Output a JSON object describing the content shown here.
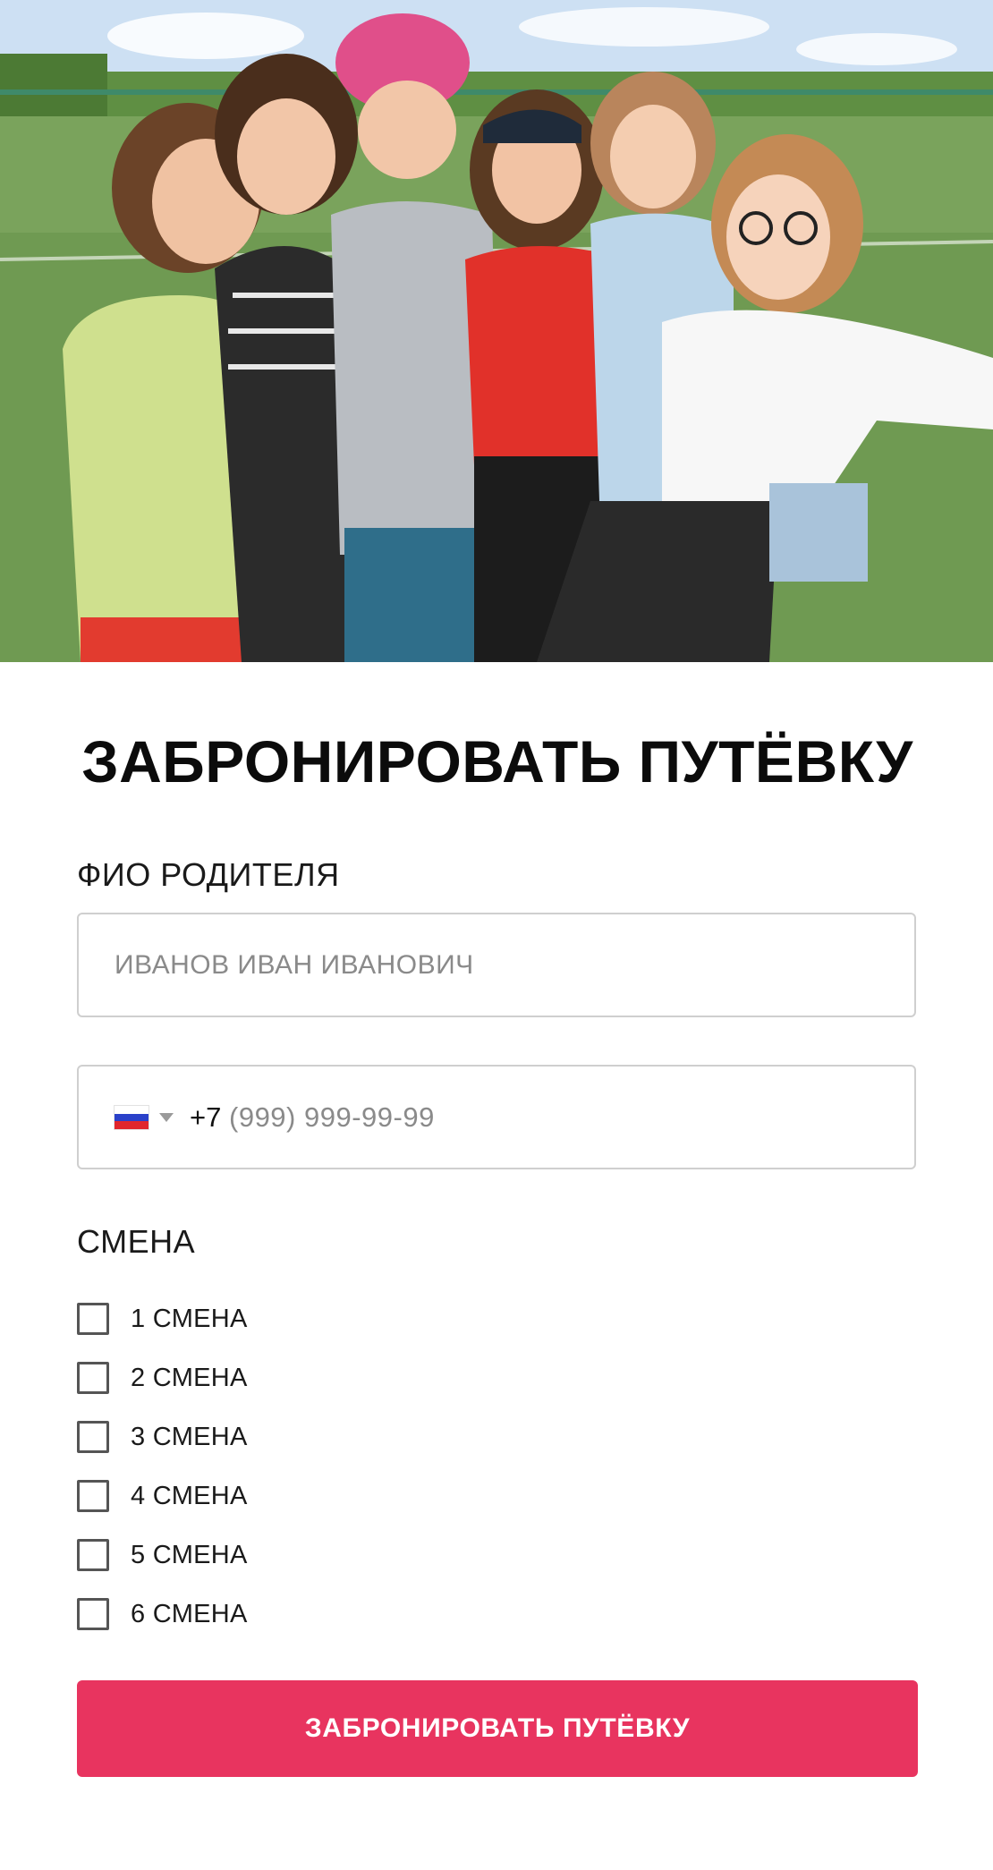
{
  "hero": {
    "image_alt": "group-photo"
  },
  "form": {
    "title": "ЗАБРОНИРОВАТЬ ПУТЁВКУ",
    "parent_name": {
      "label": "ФИО РОДИТЕЛЯ",
      "value": "",
      "placeholder": "ИВАНОВ ИВАН ИВАНОВИЧ"
    },
    "phone": {
      "country_flag": "russia-flag-icon",
      "country_code": "+7",
      "value": "",
      "placeholder": "(999) 999-99-99"
    },
    "shift": {
      "label": "СМЕНА",
      "options": [
        {
          "label": "1 СМЕНА",
          "checked": false
        },
        {
          "label": "2 СМЕНА",
          "checked": false
        },
        {
          "label": "3 СМЕНА",
          "checked": false
        },
        {
          "label": "4 СМЕНА",
          "checked": false
        },
        {
          "label": "5 СМЕНА",
          "checked": false
        },
        {
          "label": "6 СМЕНА",
          "checked": false
        }
      ]
    },
    "submit_label": "ЗАБРОНИРОВАТЬ ПУТЁВКУ"
  },
  "colors": {
    "accent": "#e8345f",
    "field_border": "#cfcfcf",
    "placeholder": "#8a8a8a"
  }
}
